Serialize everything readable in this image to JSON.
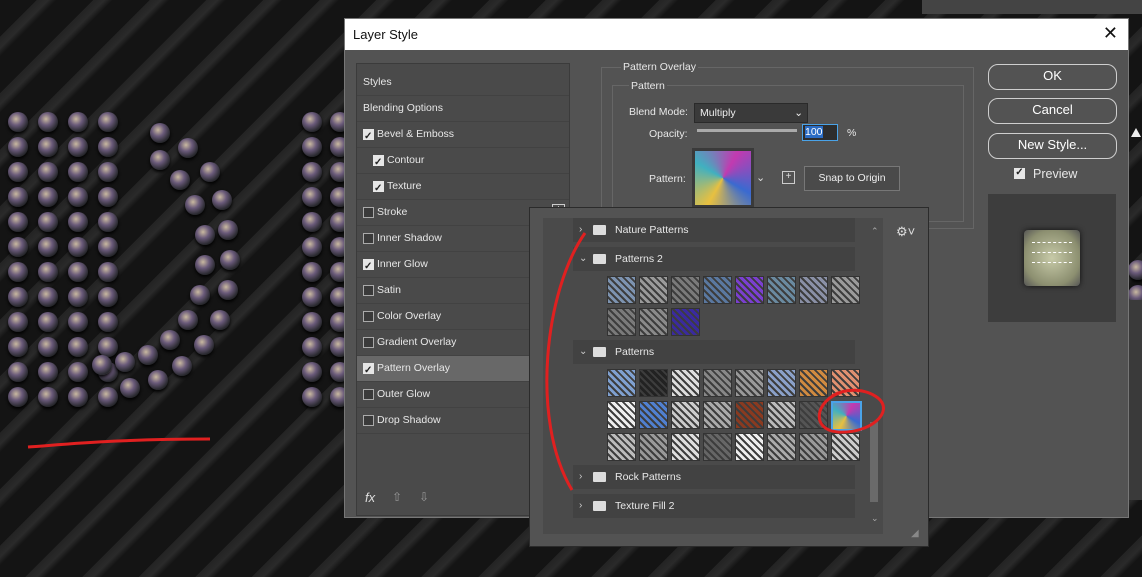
{
  "dialog": {
    "title": "Layer Style"
  },
  "styles_list": {
    "items": [
      {
        "label": "Styles",
        "checkbox": null,
        "selected": false
      },
      {
        "label": "Blending Options",
        "checkbox": null,
        "selected": false
      },
      {
        "label": "Bevel & Emboss",
        "checkbox": true,
        "selected": false
      },
      {
        "label": "Contour",
        "checkbox": true,
        "selected": false,
        "indent": true
      },
      {
        "label": "Texture",
        "checkbox": true,
        "selected": false,
        "indent": true
      },
      {
        "label": "Stroke",
        "checkbox": false,
        "selected": false,
        "plus": true
      },
      {
        "label": "Inner Shadow",
        "checkbox": false,
        "selected": false
      },
      {
        "label": "Inner Glow",
        "checkbox": true,
        "selected": false
      },
      {
        "label": "Satin",
        "checkbox": false,
        "selected": false
      },
      {
        "label": "Color Overlay",
        "checkbox": false,
        "selected": false
      },
      {
        "label": "Gradient Overlay",
        "checkbox": false,
        "selected": false
      },
      {
        "label": "Pattern Overlay",
        "checkbox": true,
        "selected": true
      },
      {
        "label": "Outer Glow",
        "checkbox": false,
        "selected": false
      },
      {
        "label": "Drop Shadow",
        "checkbox": false,
        "selected": false
      }
    ],
    "fx_label": "fx"
  },
  "pattern_overlay": {
    "section_title": "Pattern Overlay",
    "group_title": "Pattern",
    "blend_mode_label": "Blend Mode:",
    "blend_mode_value": "Multiply",
    "opacity_label": "Opacity:",
    "opacity_value": "100",
    "opacity_unit": "%",
    "opacity_level": 1.0,
    "pattern_label": "Pattern:",
    "snap_button": "Snap to Origin"
  },
  "buttons": {
    "ok": "OK",
    "cancel": "Cancel",
    "new_style": "New Style...",
    "preview_label": "Preview",
    "preview_checked": true
  },
  "picker": {
    "folders": [
      {
        "name": "Nature Patterns",
        "expanded": false
      },
      {
        "name": "Patterns 2",
        "expanded": true
      },
      {
        "name": "Patterns",
        "expanded": true
      },
      {
        "name": "Rock Patterns",
        "expanded": false
      },
      {
        "name": "Texture Fill 2",
        "expanded": false
      }
    ],
    "patterns2_colors": [
      "#7d93b0",
      "#9a9a9a",
      "#7a7a7a",
      "#5a78a0",
      "#7b3fd0",
      "#6a8aa0",
      "#8a90a6",
      "#9a9a9a",
      "#7a7a7a",
      "#8a8a8a",
      "#3a2aa0"
    ],
    "patterns_colors": [
      "#7fa0d0",
      "#222222",
      "#dddddd",
      "#888888",
      "#999999",
      "#8aa0c8",
      "#d08a40",
      "#e09070",
      "#eeeeee",
      "#5080d0",
      "#cccccc",
      "#aaaaaa",
      "#8a3a20",
      "#bbbbbb",
      "#555555",
      "#9a7ab0",
      "#bbbbbb",
      "#999999",
      "#dddddd",
      "#666666",
      "#eeeeee",
      "#aaaaaa",
      "#999999",
      "#cccccc"
    ],
    "selected_pattern_index": 15
  }
}
